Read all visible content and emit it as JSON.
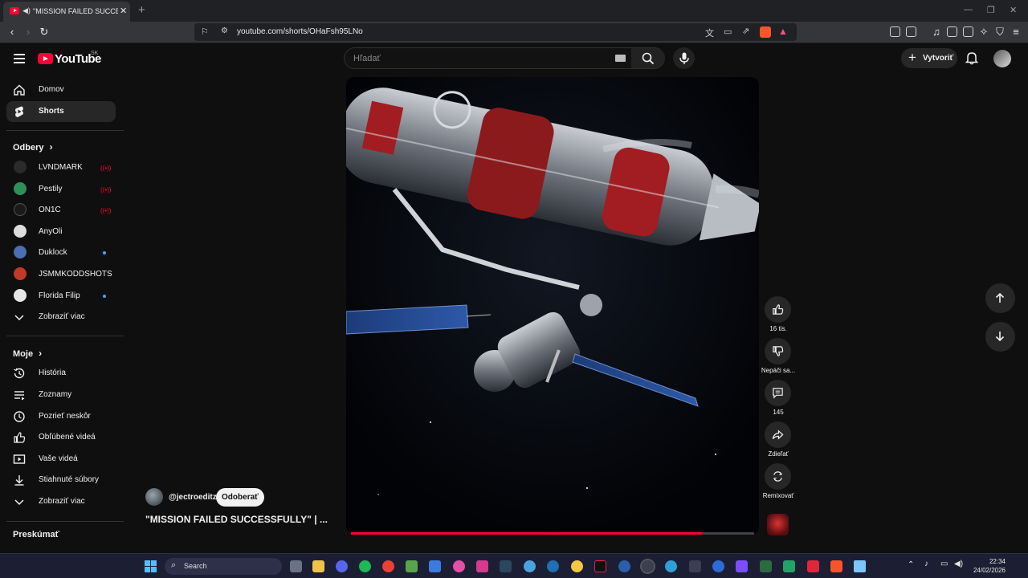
{
  "browser": {
    "tab_title": "\"MISSION FAILED SUCCESSFU",
    "url": "youtube.com/shorts/OHaFsh95LNo"
  },
  "header": {
    "logo_text": "YouTube",
    "region": "SK",
    "search_placeholder": "Hľadať",
    "create_label": "Vytvoriť"
  },
  "sidebar": {
    "main": [
      {
        "label": "Domov",
        "icon": "home-icon"
      },
      {
        "label": "Shorts",
        "icon": "shorts-icon"
      }
    ],
    "subscriptions_title": "Odbery",
    "subscriptions": [
      {
        "label": "LVNDMARK",
        "status": "live",
        "color": "#2b2b2b"
      },
      {
        "label": "Pestily",
        "status": "live",
        "color": "#2f8f5a"
      },
      {
        "label": "ON1C",
        "status": "live",
        "color": "#1a1a1a"
      },
      {
        "label": "AnyOli",
        "status": "none",
        "color": "#dddddd"
      },
      {
        "label": "Duklock",
        "status": "new",
        "color": "#4a6fb3"
      },
      {
        "label": "JSMMKODDSHOTS",
        "status": "none",
        "color": "#c0392b"
      },
      {
        "label": "Florida Filip",
        "status": "new",
        "color": "#e6e6e6"
      }
    ],
    "show_more": "Zobraziť viac",
    "you_title": "Moje",
    "you_items": [
      {
        "label": "História",
        "icon": "history-icon"
      },
      {
        "label": "Zoznamy",
        "icon": "playlists-icon"
      },
      {
        "label": "Pozrieť neskôr",
        "icon": "watch-later-icon"
      },
      {
        "label": "Obľúbené videá",
        "icon": "liked-icon"
      },
      {
        "label": "Vaše videá",
        "icon": "your-videos-icon"
      },
      {
        "label": "Stiahnuté súbory",
        "icon": "downloads-icon"
      }
    ],
    "show_more_2": "Zobraziť viac",
    "explore_title": "Preskúmať"
  },
  "short": {
    "channel": "@jectroeditz",
    "subscribe_label": "Odoberať",
    "title": "\"MISSION FAILED SUCCESSFULLY\" | ...",
    "progress": 0.87
  },
  "actions": {
    "likes": "16 tis.",
    "dislike": "Nepáči sa...",
    "comments": "145",
    "share": "Zdieľať",
    "remix": "Remixovať"
  },
  "taskbar": {
    "search_label": "Search",
    "time": "22:34",
    "date": "24/02/2026"
  }
}
